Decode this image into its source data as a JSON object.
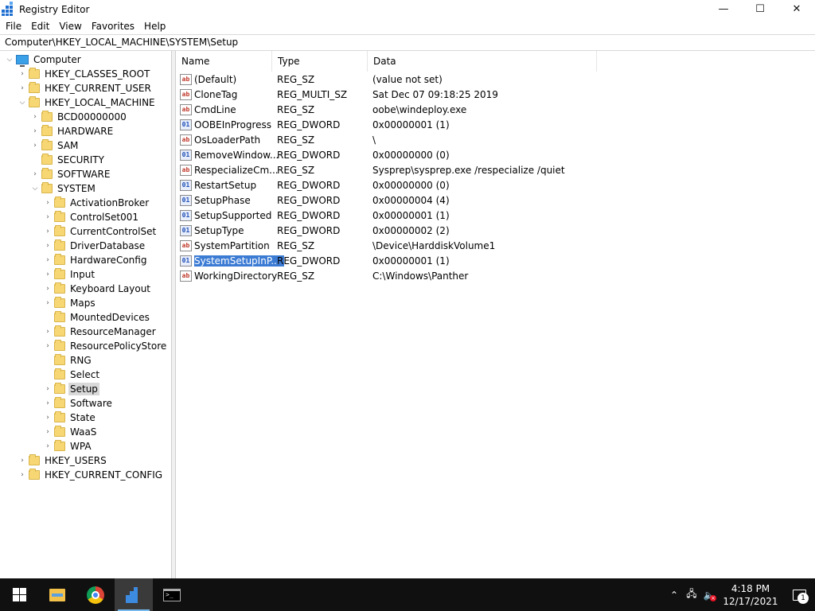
{
  "window": {
    "title": "Registry Editor",
    "controls": {
      "minimize": "—",
      "maximize": "☐",
      "close": "✕"
    }
  },
  "menu": [
    "File",
    "Edit",
    "View",
    "Favorites",
    "Help"
  ],
  "address": "Computer\\HKEY_LOCAL_MACHINE\\SYSTEM\\Setup",
  "tree": {
    "root": "Computer",
    "hives": {
      "classes_root": "HKEY_CLASSES_ROOT",
      "current_user": "HKEY_CURRENT_USER",
      "local_machine": "HKEY_LOCAL_MACHINE",
      "users": "HKEY_USERS",
      "current_config": "HKEY_CURRENT_CONFIG"
    },
    "hklm_children": [
      "BCD00000000",
      "HARDWARE",
      "SAM",
      "SECURITY",
      "SOFTWARE",
      "SYSTEM"
    ],
    "system_children": [
      "ActivationBroker",
      "ControlSet001",
      "CurrentControlSet",
      "DriverDatabase",
      "HardwareConfig",
      "Input",
      "Keyboard Layout",
      "Maps",
      "MountedDevices",
      "ResourceManager",
      "ResourcePolicyStore",
      "RNG",
      "Select",
      "Setup",
      "Software",
      "State",
      "WaaS",
      "WPA"
    ],
    "selected": "Setup"
  },
  "list": {
    "headers": {
      "name": "Name",
      "type": "Type",
      "data": "Data"
    },
    "rows": [
      {
        "name": "(Default)",
        "type": "REG_SZ",
        "data": "(value not set)",
        "icon": "ab"
      },
      {
        "name": "CloneTag",
        "type": "REG_MULTI_SZ",
        "data": "Sat Dec 07 09:18:25 2019",
        "icon": "ab"
      },
      {
        "name": "CmdLine",
        "type": "REG_SZ",
        "data": "oobe\\windeploy.exe",
        "icon": "ab"
      },
      {
        "name": "OOBEInProgress",
        "type": "REG_DWORD",
        "data": "0x00000001 (1)",
        "icon": "01"
      },
      {
        "name": "OsLoaderPath",
        "type": "REG_SZ",
        "data": "\\",
        "icon": "ab"
      },
      {
        "name": "RemoveWindow...",
        "type": "REG_DWORD",
        "data": "0x00000000 (0)",
        "icon": "01"
      },
      {
        "name": "RespecializeCm...",
        "type": "REG_SZ",
        "data": "Sysprep\\sysprep.exe /respecialize /quiet",
        "icon": "ab"
      },
      {
        "name": "RestartSetup",
        "type": "REG_DWORD",
        "data": "0x00000000 (0)",
        "icon": "01"
      },
      {
        "name": "SetupPhase",
        "type": "REG_DWORD",
        "data": "0x00000004 (4)",
        "icon": "01"
      },
      {
        "name": "SetupSupported",
        "type": "REG_DWORD",
        "data": "0x00000001 (1)",
        "icon": "01"
      },
      {
        "name": "SetupType",
        "type": "REG_DWORD",
        "data": "0x00000002 (2)",
        "icon": "01"
      },
      {
        "name": "SystemPartition",
        "type": "REG_SZ",
        "data": "\\Device\\HarddiskVolume1",
        "icon": "ab"
      },
      {
        "name": "SystemSetupInP...",
        "type": "REG_DWORD",
        "data": "0x00000001 (1)",
        "icon": "01",
        "selected": true
      },
      {
        "name": "WorkingDirectory",
        "type": "REG_SZ",
        "data": "C:\\Windows\\Panther",
        "icon": "ab"
      }
    ]
  },
  "taskbar": {
    "apps": [
      "start",
      "file-explorer",
      "chrome",
      "registry-editor",
      "command-prompt"
    ],
    "active_app": "registry-editor",
    "clock": {
      "time": "4:18 PM",
      "date": "12/17/2021"
    },
    "notification_count": "1"
  },
  "colors": {
    "selection": "#3b7bd4",
    "tree_selection": "#d9d9d9",
    "taskbar": "#101010",
    "folder": "#f7d774"
  }
}
